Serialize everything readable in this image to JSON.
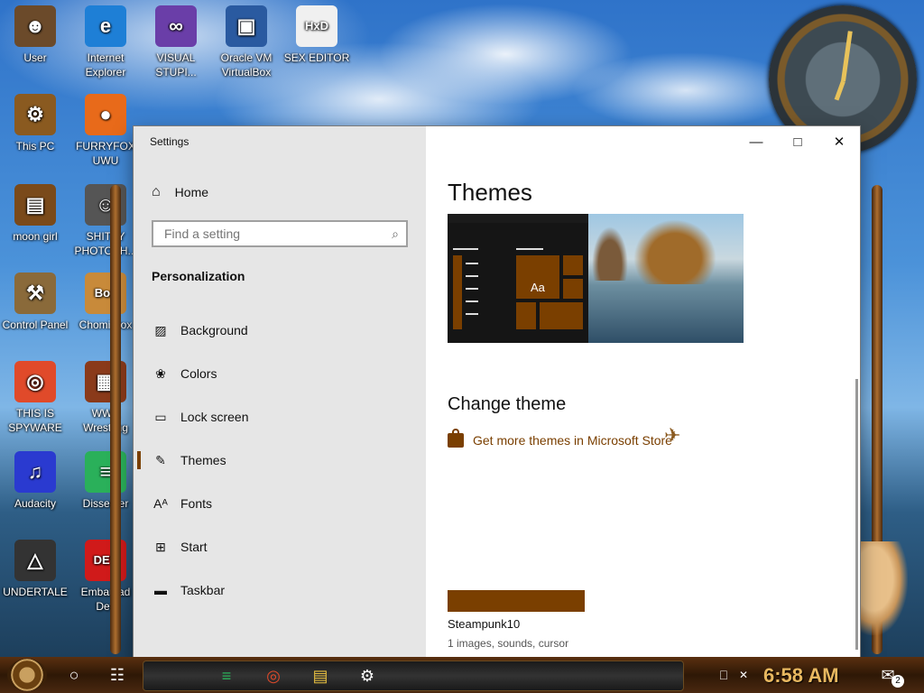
{
  "desktop": {
    "icons": [
      {
        "label": "User",
        "color": "#6b4a2a",
        "glyph": "☻"
      },
      {
        "label": "Internet Explorer",
        "color": "#1e7fd6",
        "glyph": "e"
      },
      {
        "label": "VISUAL STUPI...",
        "color": "#6a3ea8",
        "glyph": "∞"
      },
      {
        "label": "Oracle VM VirtualBox",
        "color": "#2a5aa0",
        "glyph": "▣"
      },
      {
        "label": "SEX EDITOR",
        "color": "#f0f0f0",
        "glyph": "HxD"
      },
      {
        "label": "This PC",
        "color": "#8a5a20",
        "glyph": "⚙"
      },
      {
        "label": "FURRYFOX UWU",
        "color": "#e86a1a",
        "glyph": "●"
      },
      {
        "label": "moon girl",
        "color": "#7a4a1a",
        "glyph": "▤"
      },
      {
        "label": "SHITTY PHOTOSH...",
        "color": "#555",
        "glyph": "☺"
      },
      {
        "label": "Control Panel",
        "color": "#8a6a3a",
        "glyph": "⚒"
      },
      {
        "label": "Chomi Box",
        "color": "#c88a3a",
        "glyph": "Box"
      },
      {
        "label": "THIS IS SPYWARE",
        "color": "#e04a2a",
        "glyph": "◎"
      },
      {
        "label": "WWE Wrestling",
        "color": "#8a3a1a",
        "glyph": "▦"
      },
      {
        "label": "Audacity",
        "color": "#2a3ad0",
        "glyph": "♫"
      },
      {
        "label": "Dissenter",
        "color": "#2ab05a",
        "glyph": "≡"
      },
      {
        "label": "UNDERTALE",
        "color": "#333",
        "glyph": "△"
      },
      {
        "label": "Embarcad Dev",
        "color": "#d01a1a",
        "glyph": "DEV"
      }
    ]
  },
  "window": {
    "title": "Settings",
    "minimize_glyph": "—",
    "maximize_glyph": "□",
    "close_glyph": "✕"
  },
  "nav": {
    "home_label": "Home",
    "home_icon": "⌂",
    "search_placeholder": "Find a setting",
    "search_icon": "⌕",
    "section_title": "Personalization",
    "items": [
      {
        "label": "Background",
        "icon": "▨"
      },
      {
        "label": "Colors",
        "icon": "❀"
      },
      {
        "label": "Lock screen",
        "icon": "▭"
      },
      {
        "label": "Themes",
        "icon": "✎"
      },
      {
        "label": "Fonts",
        "icon": "Aᴬ"
      },
      {
        "label": "Start",
        "icon": "⊞"
      },
      {
        "label": "Taskbar",
        "icon": "▬"
      }
    ],
    "active_index": 3
  },
  "main": {
    "page_title": "Themes",
    "preview_tile_text": "Aa",
    "change_theme_heading": "Change theme",
    "store_link": "Get more themes in Microsoft Store",
    "theme": {
      "name": "Steampunk10",
      "details": "1 images, sounds, cursor",
      "swatch_color": "#7a3f00"
    }
  },
  "taskbar": {
    "time": "6:58 AM",
    "notification_count": "2",
    "search_glyph": "○",
    "taskview_glyph": "☷",
    "apps": [
      {
        "name": "dissenter-icon",
        "glyph": "≡",
        "color": "#2ab05a"
      },
      {
        "name": "chrome-icon",
        "glyph": "◎",
        "color": "#e04a2a"
      },
      {
        "name": "file-explorer-icon",
        "glyph": "▤",
        "color": "#e8c040"
      },
      {
        "name": "settings-icon",
        "glyph": "⚙",
        "color": "#ffffff"
      }
    ],
    "tray_glyphs": {
      "network": "⎕",
      "volume": "✕",
      "notifications": "✉"
    }
  },
  "colors": {
    "accent": "#7a3f00",
    "nav_background": "#e6e6e6"
  }
}
